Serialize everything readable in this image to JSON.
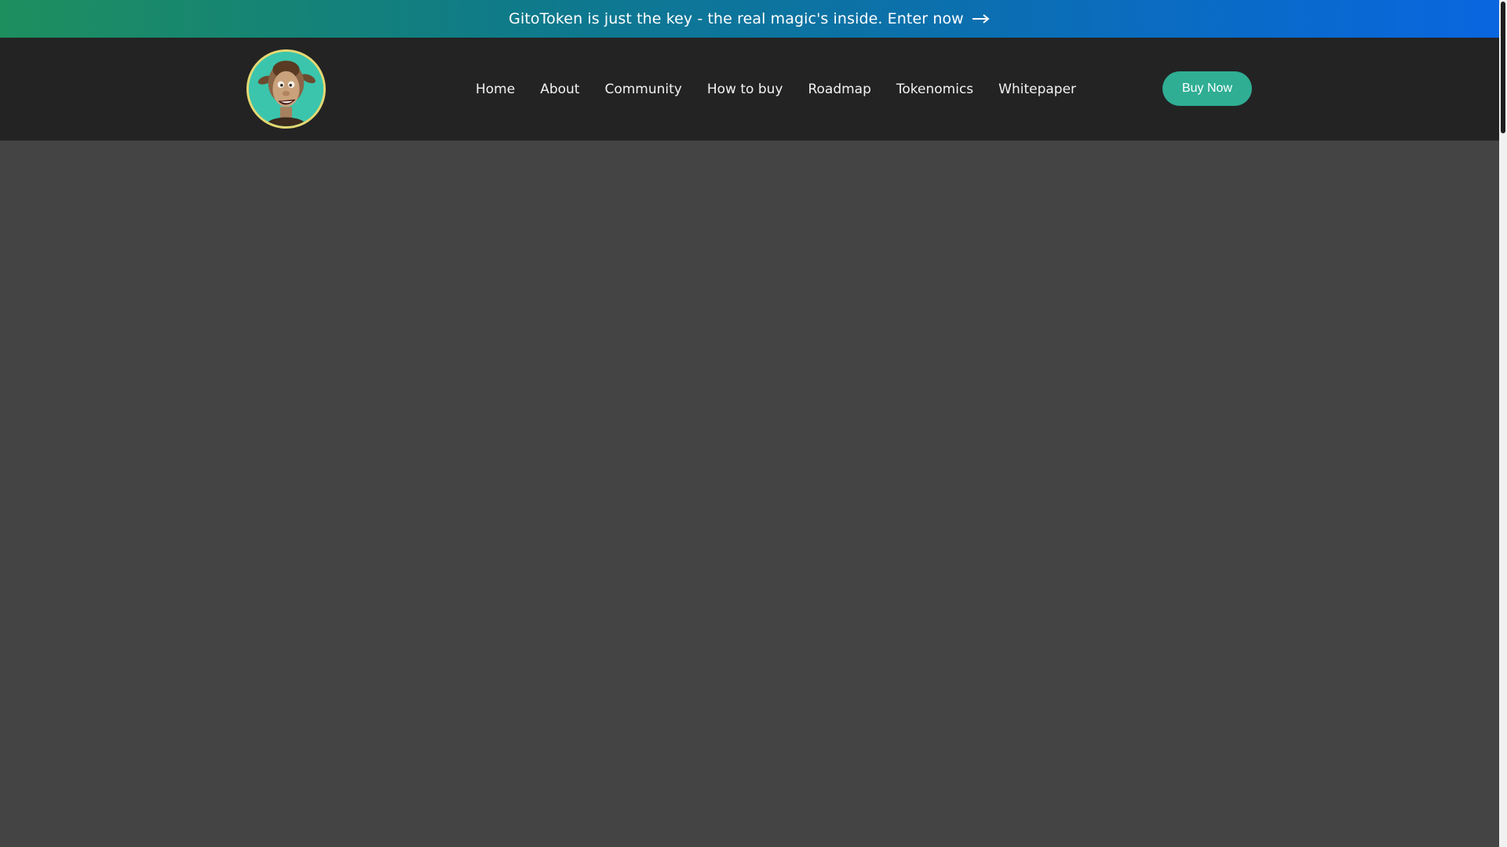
{
  "announcement": {
    "text": "GitoToken is just the key - the real magic's inside. Enter now",
    "icon": "arrow-right-icon"
  },
  "header": {
    "logo_icon": "cartoon-character-logo",
    "nav": [
      {
        "label": "Home"
      },
      {
        "label": "About"
      },
      {
        "label": "Community"
      },
      {
        "label": "How to buy"
      },
      {
        "label": "Roadmap"
      },
      {
        "label": "Tokenomics"
      },
      {
        "label": "Whitepaper"
      }
    ],
    "buy_label": "Buy Now"
  },
  "colors": {
    "announcement_gradient_start": "#1d8f5e",
    "announcement_gradient_end": "#0a66e0",
    "header_bg": "#232323",
    "page_bg": "#444444",
    "accent": "#2fae94",
    "logo_bg": "#3bc5ad",
    "logo_ring": "#e5d873"
  }
}
